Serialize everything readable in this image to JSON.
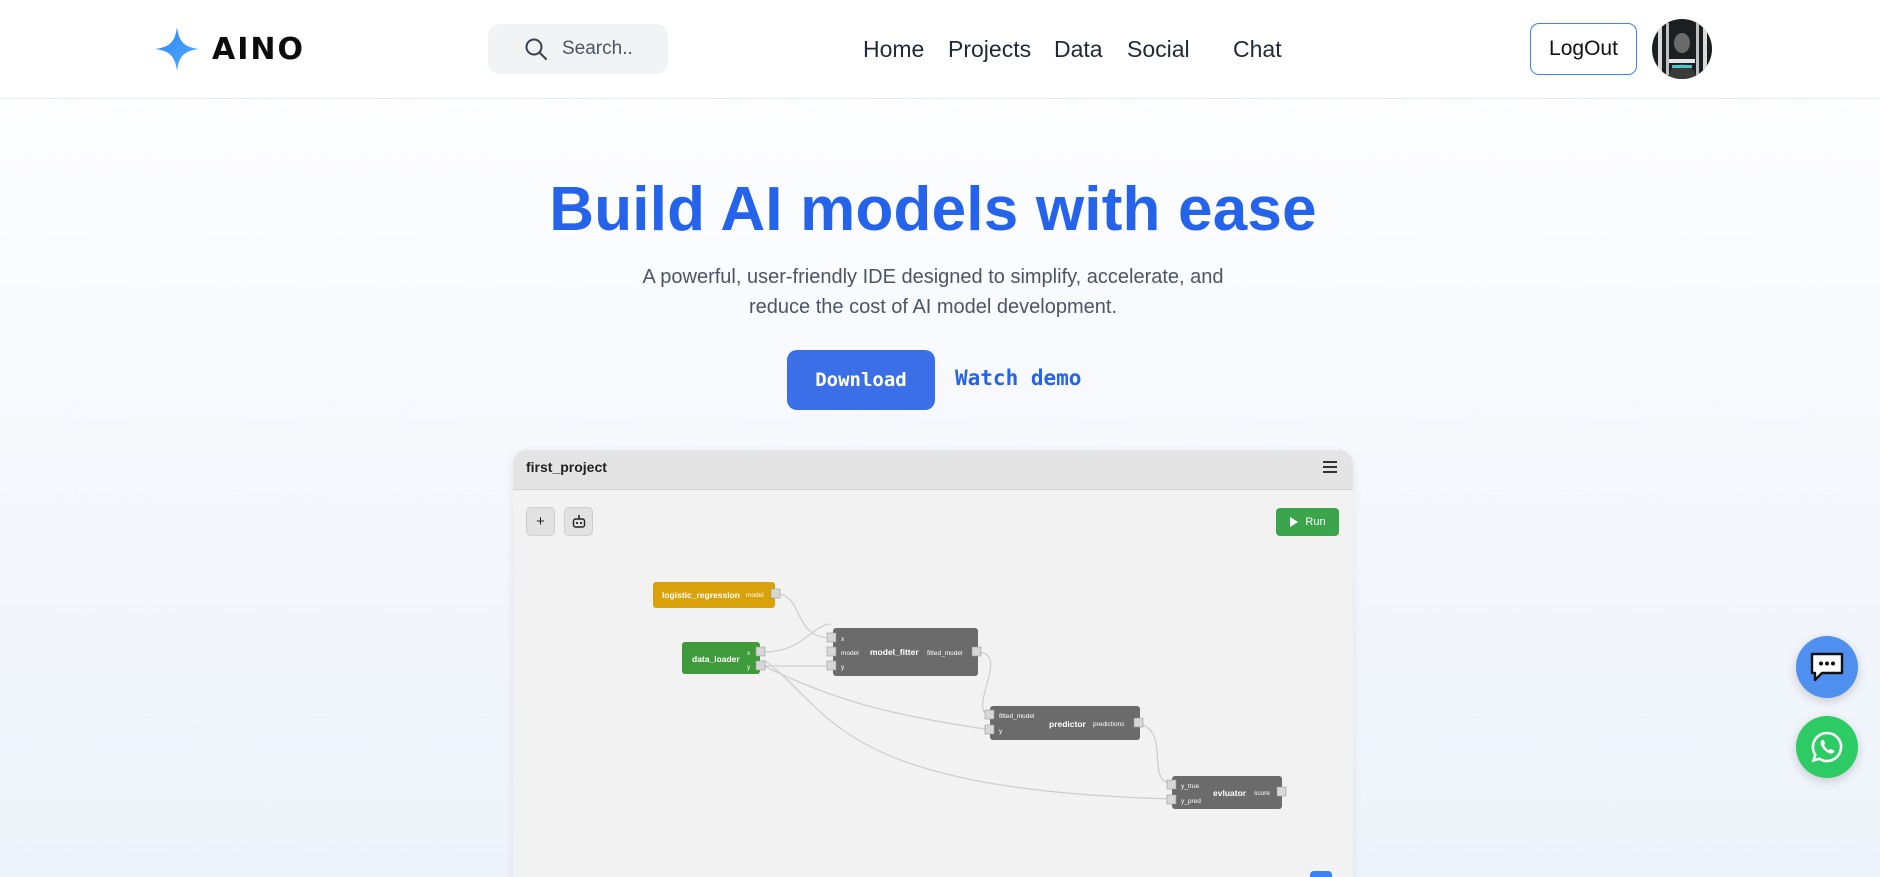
{
  "header": {
    "brand": "AINO",
    "search_placeholder": "Search..",
    "nav": [
      "Home",
      "Projects",
      "Data",
      "Social",
      "Chat"
    ],
    "logout_label": "LogOut"
  },
  "hero": {
    "title": "Build AI models with ease",
    "subtitle_line1": "A powerful, user-friendly IDE designed to simplify, accelerate, and",
    "subtitle_line2": "reduce the cost of AI model development.",
    "download_label": "Download",
    "demo_label": "Watch demo"
  },
  "ide": {
    "project_name": "first_project",
    "add_label": "+",
    "run_label": "Run",
    "nodes": {
      "logistic_regression": {
        "title": "logistic_regression",
        "out": "model"
      },
      "data_loader": {
        "title": "data_loader",
        "out_x": "x",
        "out_y": "y"
      },
      "model_fitter": {
        "title": "model_fitter",
        "in_x": "x",
        "in_model": "model",
        "in_y": "y",
        "out": "fitted_model"
      },
      "predictor": {
        "title": "predictor",
        "in_fitted": "fitted_model",
        "in_y": "y",
        "out": "predictions"
      },
      "evaluator": {
        "title": "evluator",
        "in_true": "y_true",
        "in_pred": "y_pred",
        "out": "score"
      }
    }
  },
  "colors": {
    "accent": "#2563eb",
    "download_bg": "#3b6fe8",
    "node_orange": "#d9a10a",
    "node_green": "#3e9a3a",
    "node_gray": "#6b6b6b",
    "run_green": "#3aa54b",
    "chat_fab": "#4f8ff0",
    "whatsapp_fab": "#2ccb64"
  },
  "icons": [
    "aino-star-logo",
    "search-icon",
    "avatar",
    "menu-icon",
    "robot-icon",
    "play-icon",
    "chat-bubble-icon",
    "whatsapp-icon"
  ]
}
